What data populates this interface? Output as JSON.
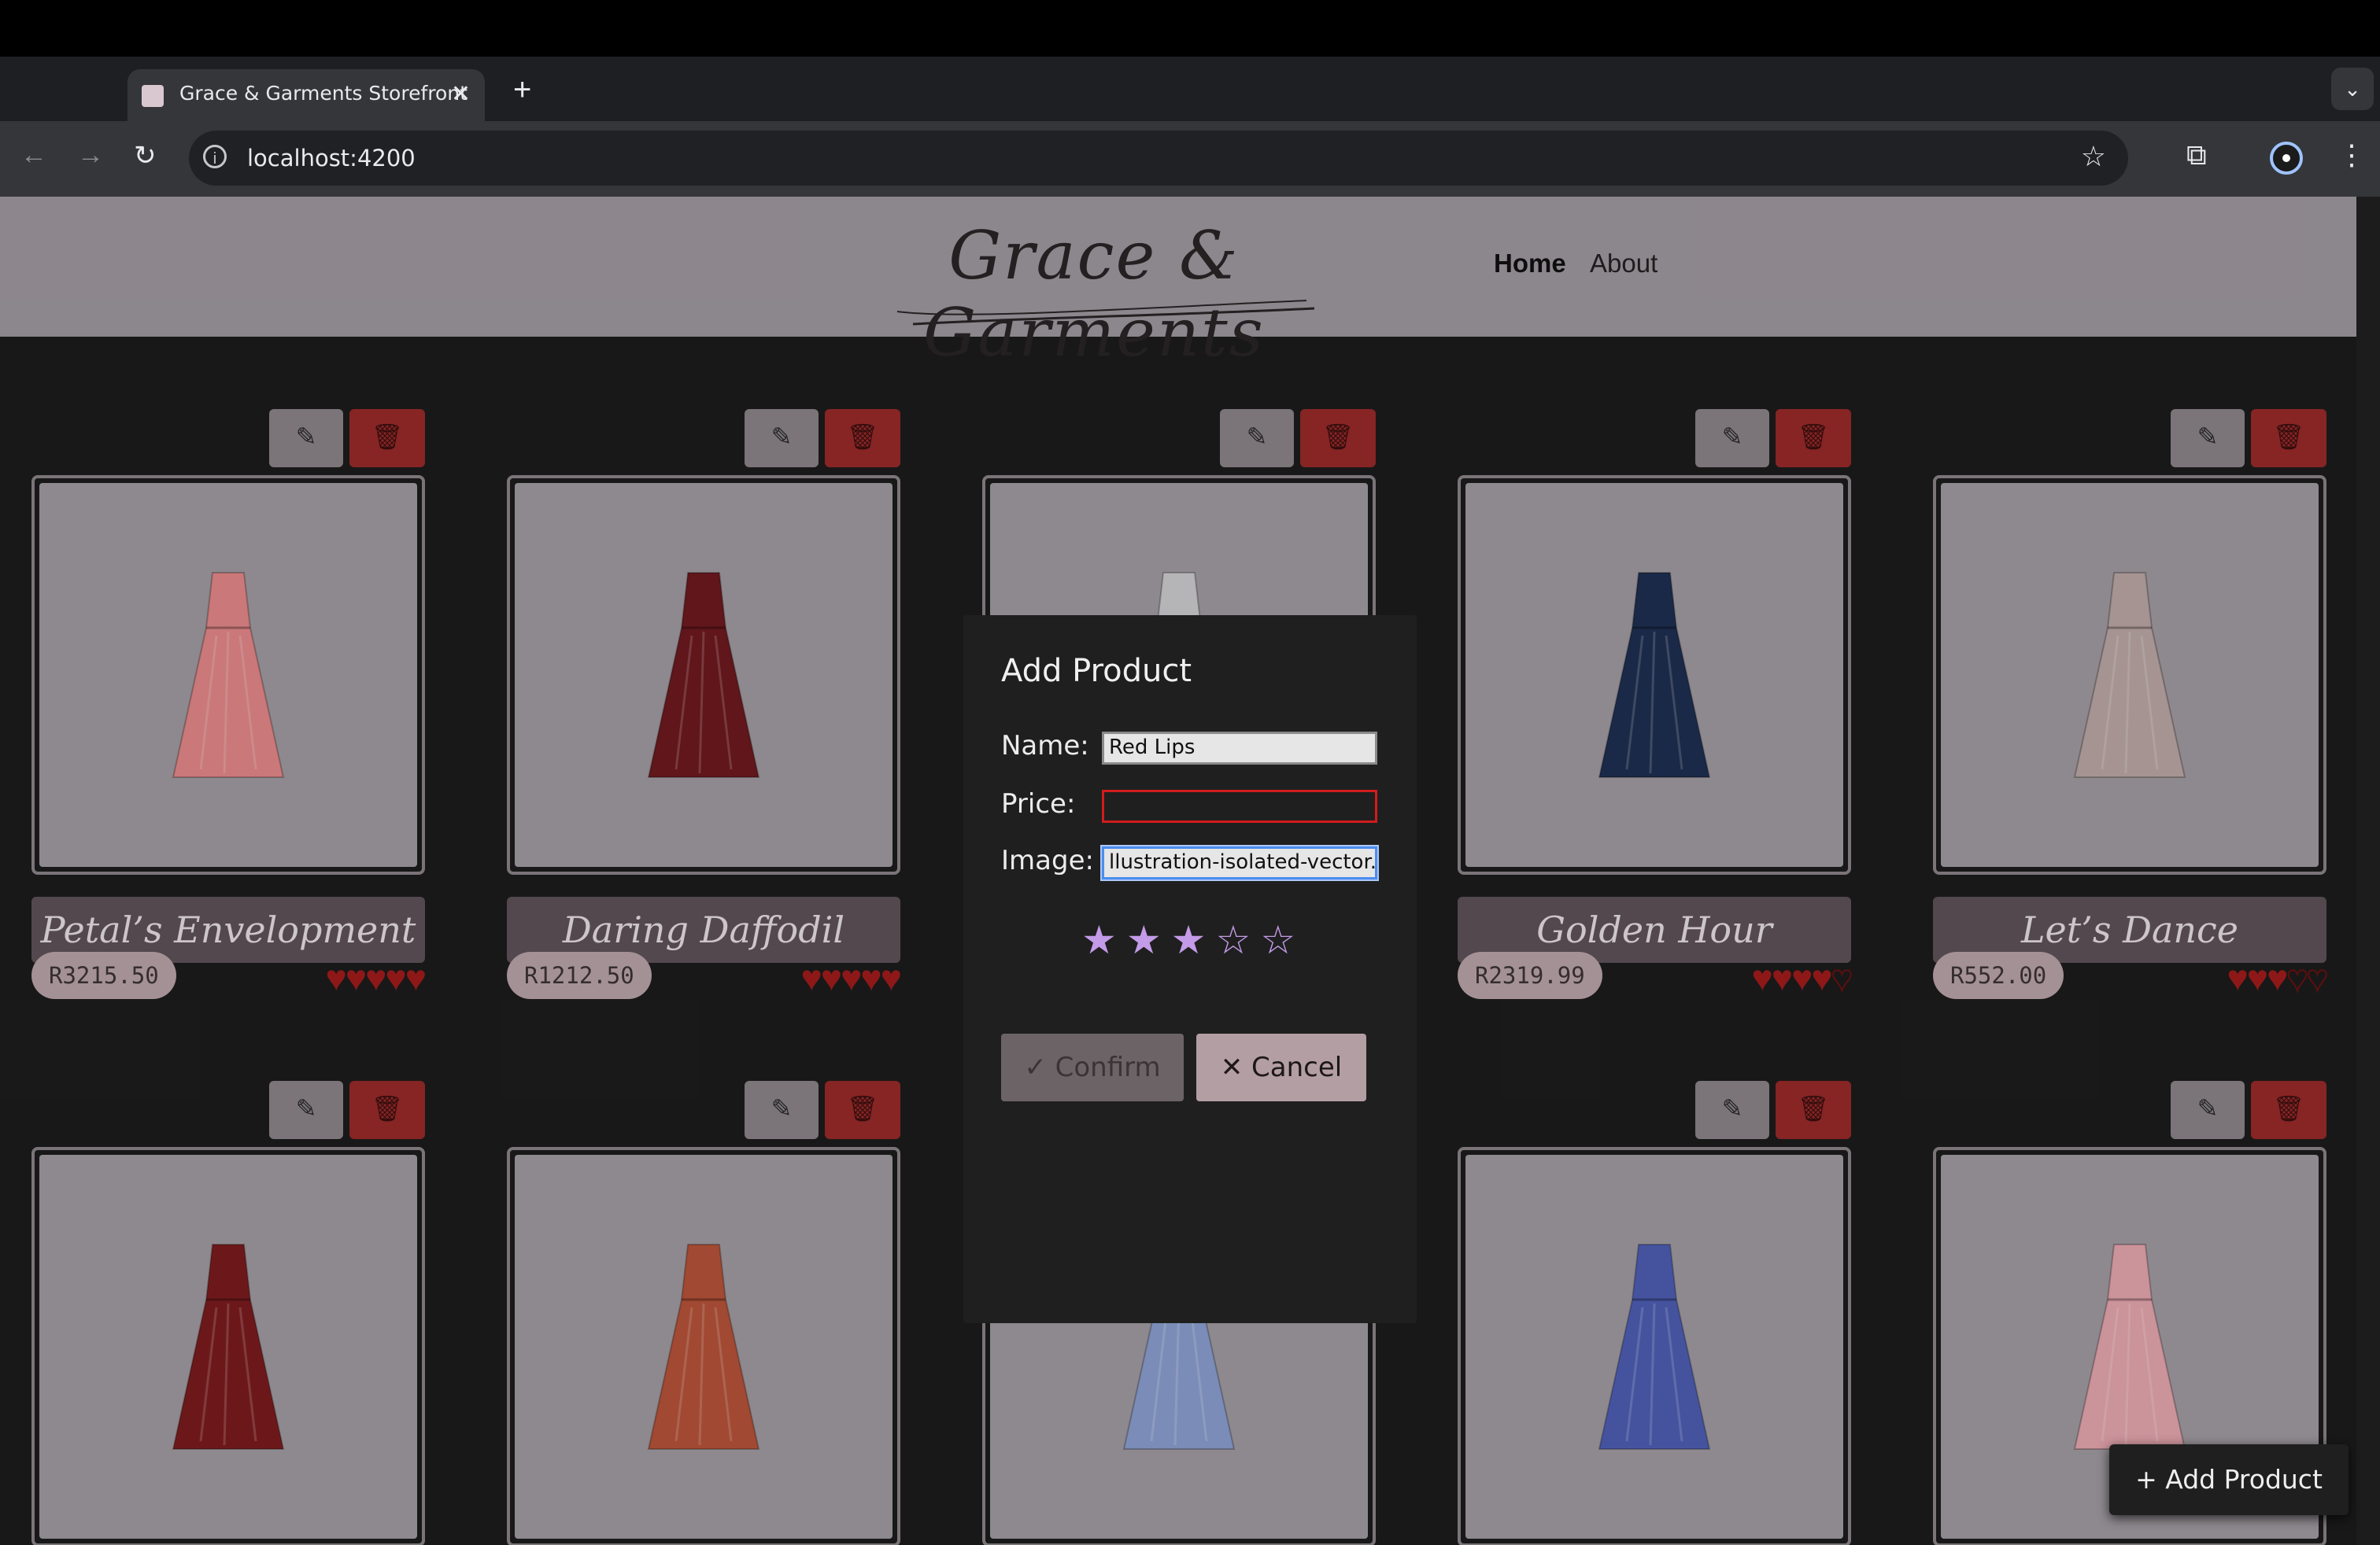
{
  "browser": {
    "tab_title": "Grace & Garments Storefront",
    "tab_close": "✕",
    "new_tab": "+",
    "url": "localhost:4200",
    "icons": [
      "back-arrow-icon",
      "forward-arrow-icon",
      "reload-icon",
      "info-icon",
      "star-icon",
      "extensions-icon",
      "profile-icon",
      "kebab-menu-icon",
      "chevron-down-icon"
    ]
  },
  "site": {
    "logo_text": "Grace & Garments",
    "nav": {
      "home": "Home",
      "about": "About"
    }
  },
  "products": [
    {
      "name": "Petal’s Envelopment",
      "price": "R3215.50",
      "rating": 5,
      "dress_color": "#e6898a"
    },
    {
      "name": "Daring Daffodil",
      "price": "R1212.50",
      "rating": 5,
      "dress_color": "#6e1a1f"
    },
    {
      "name": "",
      "price": "",
      "rating": 0,
      "dress_color": "#cfcdd0"
    },
    {
      "name": "Golden Hour",
      "price": "R2319.99",
      "rating": 4,
      "dress_color": "#1f2f52"
    },
    {
      "name": "Let’s Dance",
      "price": "R552.00",
      "rating": 3,
      "dress_color": "#bca9a6"
    },
    {
      "name": "",
      "price": "",
      "rating": 0,
      "dress_color": "#7c1c1e"
    },
    {
      "name": "",
      "price": "",
      "rating": 0,
      "dress_color": "#b8543a"
    },
    {
      "name": "",
      "price": "",
      "rating": 0,
      "dress_color": "#8da0d2"
    },
    {
      "name": "",
      "price": "",
      "rating": 0,
      "dress_color": "#4f5fb6"
    },
    {
      "name": "",
      "price": "",
      "rating": 0,
      "dress_color": "#e8a8b0"
    }
  ],
  "modal": {
    "title": "Add Product",
    "name_label": "Name:",
    "name_value": "Red Lips",
    "price_label": "Price:",
    "price_value": "",
    "image_label": "Image:",
    "image_value": "llustration-isolated-vector.jpg",
    "rating": 3,
    "rating_max": 5,
    "star_filled": "★",
    "star_empty": "☆",
    "confirm_label": "✓  Confirm",
    "cancel_label": "✕  Cancel"
  },
  "fab": {
    "label": "+  Add Product"
  },
  "colors": {
    "accent_star": "#c49be8",
    "danger": "#9a2a2a",
    "heart": "#a21c1c"
  }
}
